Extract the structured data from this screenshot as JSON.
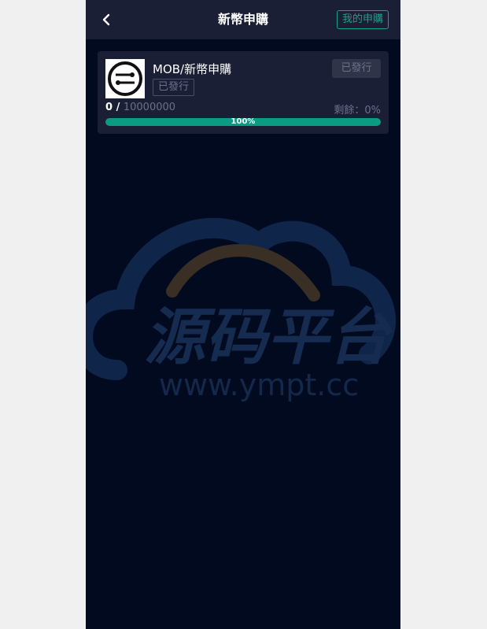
{
  "header": {
    "title": "新幣申購",
    "my_subscriptions_label": "我的申購",
    "back_icon": "chevron-left-icon"
  },
  "card": {
    "coin_name": "MOB/新幣申購",
    "status_tag": "已發行",
    "action_label": "已發行",
    "sold": "0",
    "separator": " / ",
    "total": "10000000",
    "remaining_label": "剩餘：",
    "remaining_value": "0%",
    "progress": 100,
    "progress_label": "100%"
  },
  "watermark": {
    "main_text": "源码平台",
    "url_text": "www.ympt.cc"
  },
  "colors": {
    "background": "#020a1f",
    "header": "#1a1f36",
    "accent": "#17a386",
    "progress": "#0b9b82",
    "muted": "#6c718a"
  }
}
